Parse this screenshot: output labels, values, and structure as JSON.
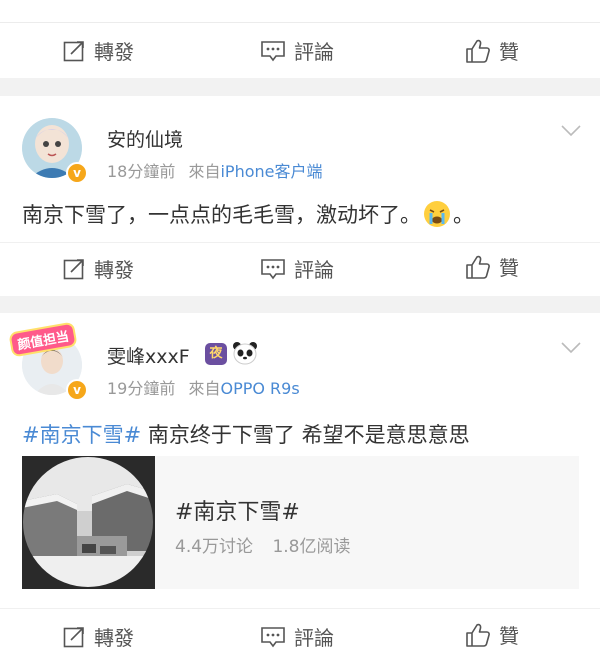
{
  "actions": {
    "repost": "轉發",
    "comment": "評論",
    "like": "贊"
  },
  "post2": {
    "username": "安的仙境",
    "time": "18分鐘前",
    "from_label": "來自",
    "source": "iPhone客户端",
    "text": "南京下雪了，一点点的毛毛雪，激动坏了。",
    "text_end": "。",
    "emoji": "crying-face-icon"
  },
  "post3": {
    "username": "雯峰xxxF",
    "time": "19分鐘前",
    "from_label": "來自",
    "source": "OPPO R9s",
    "topic": "#南京下雪#",
    "text": "南京终于下雪了 希望不是意思意思",
    "avatar_badge": "颜值担当",
    "card": {
      "title": "#南京下雪#",
      "discuss": "4.4万讨论",
      "reads": "1.8亿阅读"
    }
  },
  "colors": {
    "link": "#4a8ad4",
    "vip": "#f6a71a",
    "divider": "#f2f2f2"
  }
}
